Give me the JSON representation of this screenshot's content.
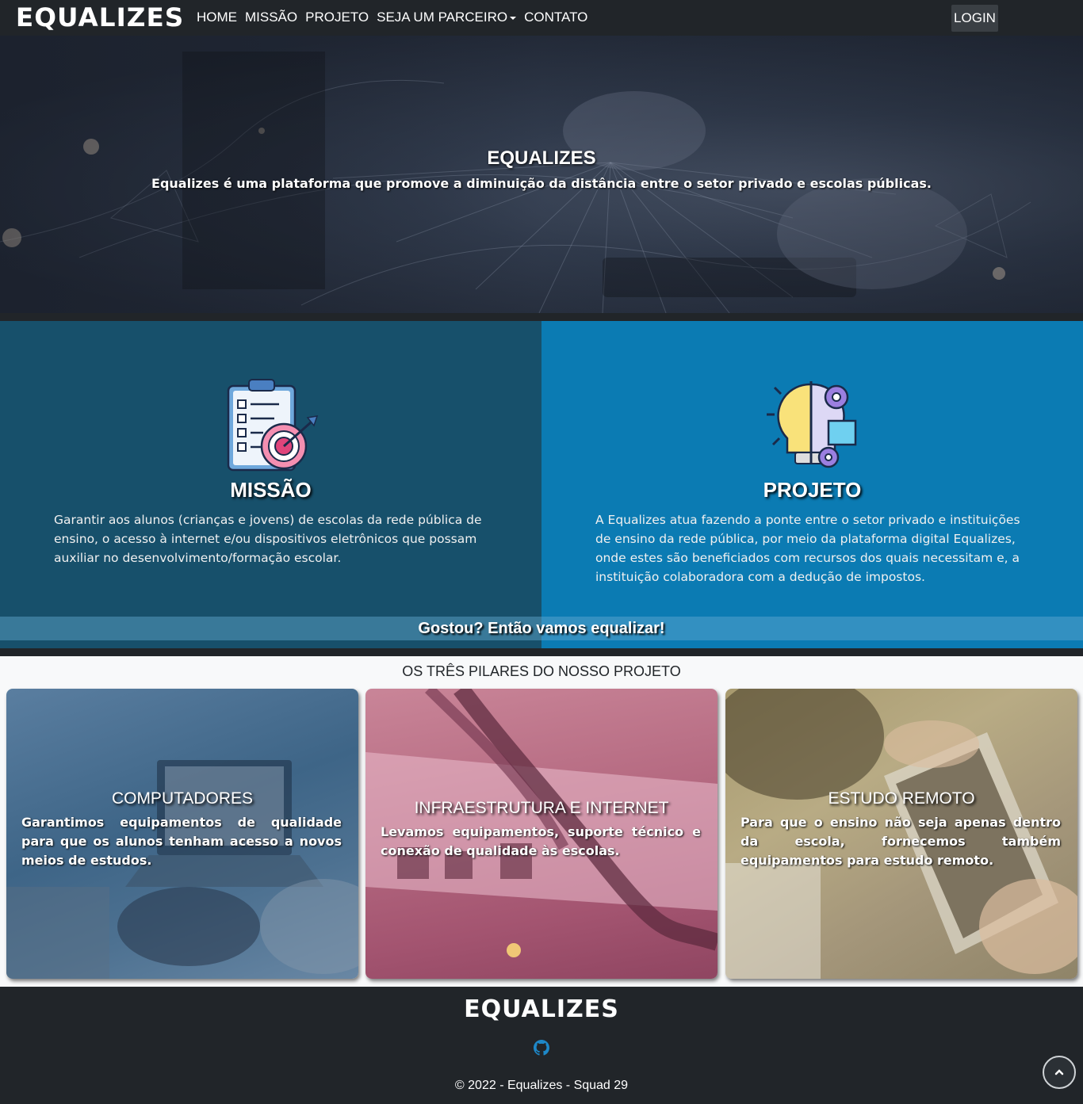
{
  "navbar": {
    "brand": "EQUALIZES",
    "links": [
      "HOME",
      "MISSÃO",
      "PROJETO",
      "SEJA UM PARCEIRO",
      "CONTATO"
    ],
    "login": "LOGIN"
  },
  "hero": {
    "title": "EQUALIZES",
    "subtitle": "Equalizes é uma plataforma que promove a diminuição da distância entre o setor privado e escolas públicas."
  },
  "mission": {
    "icon": "clipboard-target-icon",
    "title": "MISSÃO",
    "text": "Garantir aos alunos (crianças e jovens) de escolas da rede pública de ensino, o acesso à internet e/ou dispositivos eletrônicos que possam auxiliar no desenvolvimento/formação escolar."
  },
  "project": {
    "icon": "lightbulb-gears-icon",
    "title": "PROJETO",
    "text": "A Equalizes atua fazendo a ponte entre o setor privado e instituições de ensino da rede pública, por meio da plataforma digital Equalizes, onde estes são beneficiados com recursos dos quais necessitam e, a instituição colaboradora com a dedução de impostos."
  },
  "cta": "Gostou? Então vamos equalizar!",
  "pillars": {
    "title": "OS TRÊS PILARES DO NOSSO PROJETO",
    "cards": [
      {
        "title": "COMPUTADORES",
        "text": "Garantimos equipamentos de qualidade para que os alunos tenham acesso a novos meios de estudos."
      },
      {
        "title": "INFRAESTRUTURA E INTERNET",
        "text": "Levamos equipamentos, suporte técnico e conexão de qualidade às escolas."
      },
      {
        "title": "ESTUDO REMOTO",
        "text": "Para que o ensino não seja apenas dentro da escola, fornecemos também equipamentos para estudo remoto."
      }
    ]
  },
  "footer": {
    "brand": "EQUALIZES",
    "github_icon": "github-icon",
    "copyright": "© 2022 - Equalizes - Squad 29"
  },
  "colors": {
    "dark": "#212529",
    "mission_bg": "#17506b",
    "project_bg": "#0b7bb3",
    "pillars_bg": "#f8f9fa"
  }
}
